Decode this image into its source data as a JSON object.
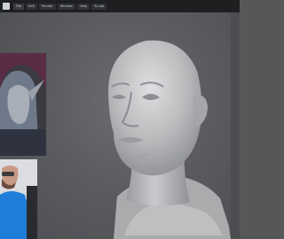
{
  "menubar": {
    "items": [
      "File",
      "Edit",
      "Render",
      "Window",
      "Help",
      "Sculpt"
    ]
  },
  "reference_panel": {
    "content": "reference-character-portrait"
  },
  "webcam_panel": {
    "content": "streamer-webcam"
  },
  "viewport": {
    "content": "sculpted-head-bust-model"
  },
  "colors": {
    "viewport_bg": "#5a5c5f",
    "menubar_bg": "#1e1f21",
    "clay": "#c8c9cb",
    "webcam_shirt": "#1f7fd8"
  }
}
